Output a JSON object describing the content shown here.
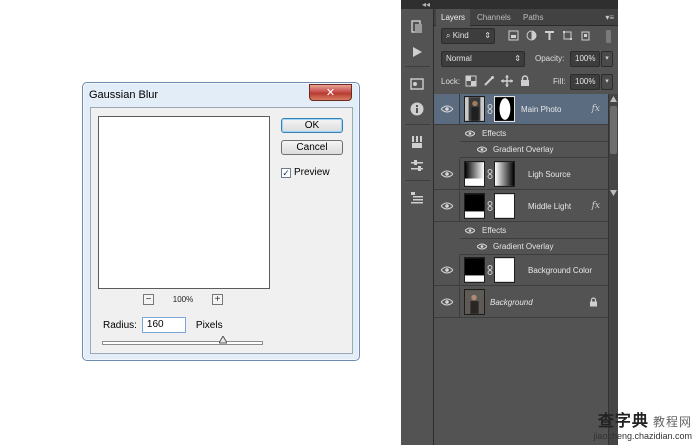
{
  "dialog": {
    "title": "Gaussian Blur",
    "close_glyph": "✕",
    "ok_label": "OK",
    "cancel_label": "Cancel",
    "preview_label": "Preview",
    "preview_checked": true,
    "zoom_minus": "−",
    "zoom_plus": "+",
    "zoom_level": "100%",
    "radius_label": "Radius:",
    "radius_value": "160",
    "units_label": "Pixels",
    "slider_fraction": 0.75
  },
  "panel": {
    "tabs": [
      "Layers",
      "Channels",
      "Paths"
    ],
    "active_tab": "Layers",
    "filter_kind": "Kind",
    "blend_mode": "Normal",
    "opacity_label": "Opacity:",
    "opacity_value": "100%",
    "lock_label": "Lock:",
    "fill_label": "Fill:",
    "fill_value": "100%",
    "layers": [
      {
        "name": "Main Photo",
        "fx": "fx",
        "selected": true
      },
      {
        "name": "Ligh Source",
        "fx": ""
      },
      {
        "name": "Middle Light",
        "fx": "fx"
      },
      {
        "name": "Background Color",
        "fx": ""
      },
      {
        "name": "Background",
        "fx": "",
        "locked": true
      }
    ],
    "effects_label": "Effects",
    "gradient_overlay_label": "Gradient Overlay"
  },
  "watermark": {
    "main": "查字典",
    "brand": "教程网",
    "url": "jiaocheng.chazidian.com"
  },
  "colors": {
    "panel_bg": "#535353",
    "selected_row": "#5b6b80",
    "dialog_bg": "#f0f0f0",
    "close_button": "#c75050"
  }
}
